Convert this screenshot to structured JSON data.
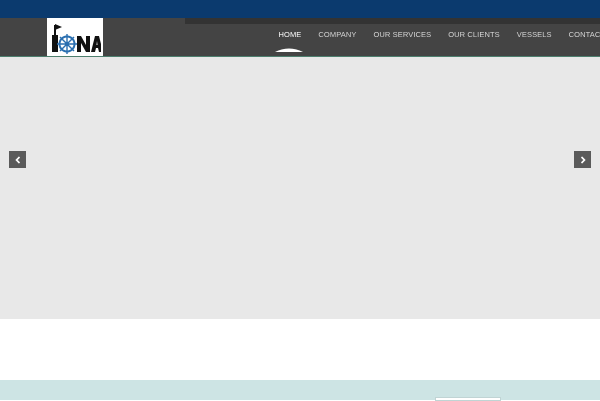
{
  "logo": {
    "text": "IONA",
    "icon": "ship-wheel-icon"
  },
  "nav": {
    "items": [
      {
        "label": "HOME",
        "active": true
      },
      {
        "label": "COMPANY",
        "active": false
      },
      {
        "label": "OUR SERVICES",
        "active": false
      },
      {
        "label": "OUR CLIENTS",
        "active": false
      },
      {
        "label": "VESSELS",
        "active": false
      },
      {
        "label": "CONTACT",
        "active": false
      }
    ]
  },
  "slider": {
    "prev_icon": "chevron-left-icon",
    "next_icon": "chevron-right-icon"
  },
  "colors": {
    "topbar": "#0b3a6e",
    "header": "#444444",
    "slider_bg": "#e8e8e8",
    "band": "#cde4e4"
  }
}
